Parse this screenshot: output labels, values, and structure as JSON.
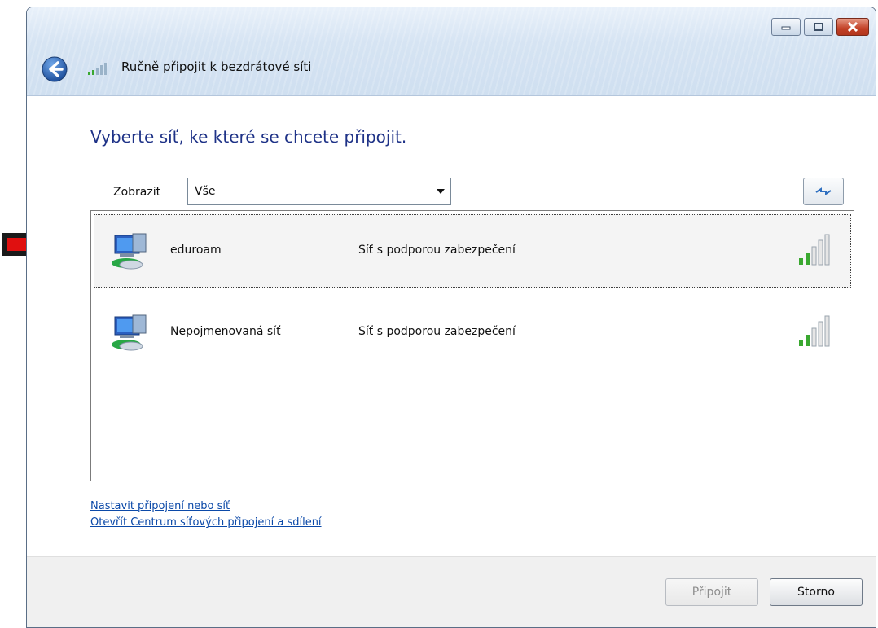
{
  "window": {
    "title": "Ručně připojit k bezdrátové síti"
  },
  "heading": "Vyberte síť, ke které se chcete připojit.",
  "filter": {
    "label": "Zobrazit",
    "selected": "Vše"
  },
  "networks": [
    {
      "name": "eduroam",
      "security": "Síť s podporou zabezpečení",
      "signal_bars": 2,
      "selected": true
    },
    {
      "name": "Nepojmenovaná síť",
      "security": "Síť s podporou zabezpečení",
      "signal_bars": 2,
      "selected": false
    }
  ],
  "links": {
    "setup": "Nastavit připojení nebo síť",
    "center": "Otevřít Centrum síťových připojení a sdílení"
  },
  "buttons": {
    "connect": "Připojit",
    "cancel": "Storno"
  },
  "icons": {
    "back": "back-arrow-icon",
    "title": "wireless-signal-icon",
    "network": "network-computer-icon",
    "signal": "signal-strength-icon",
    "refresh": "refresh-icon",
    "marker": "red-arrow-icon"
  },
  "colors": {
    "heading": "#1e3287",
    "link": "#0b49a8",
    "signal_active": "#3aa830",
    "marker": "#e01010"
  }
}
